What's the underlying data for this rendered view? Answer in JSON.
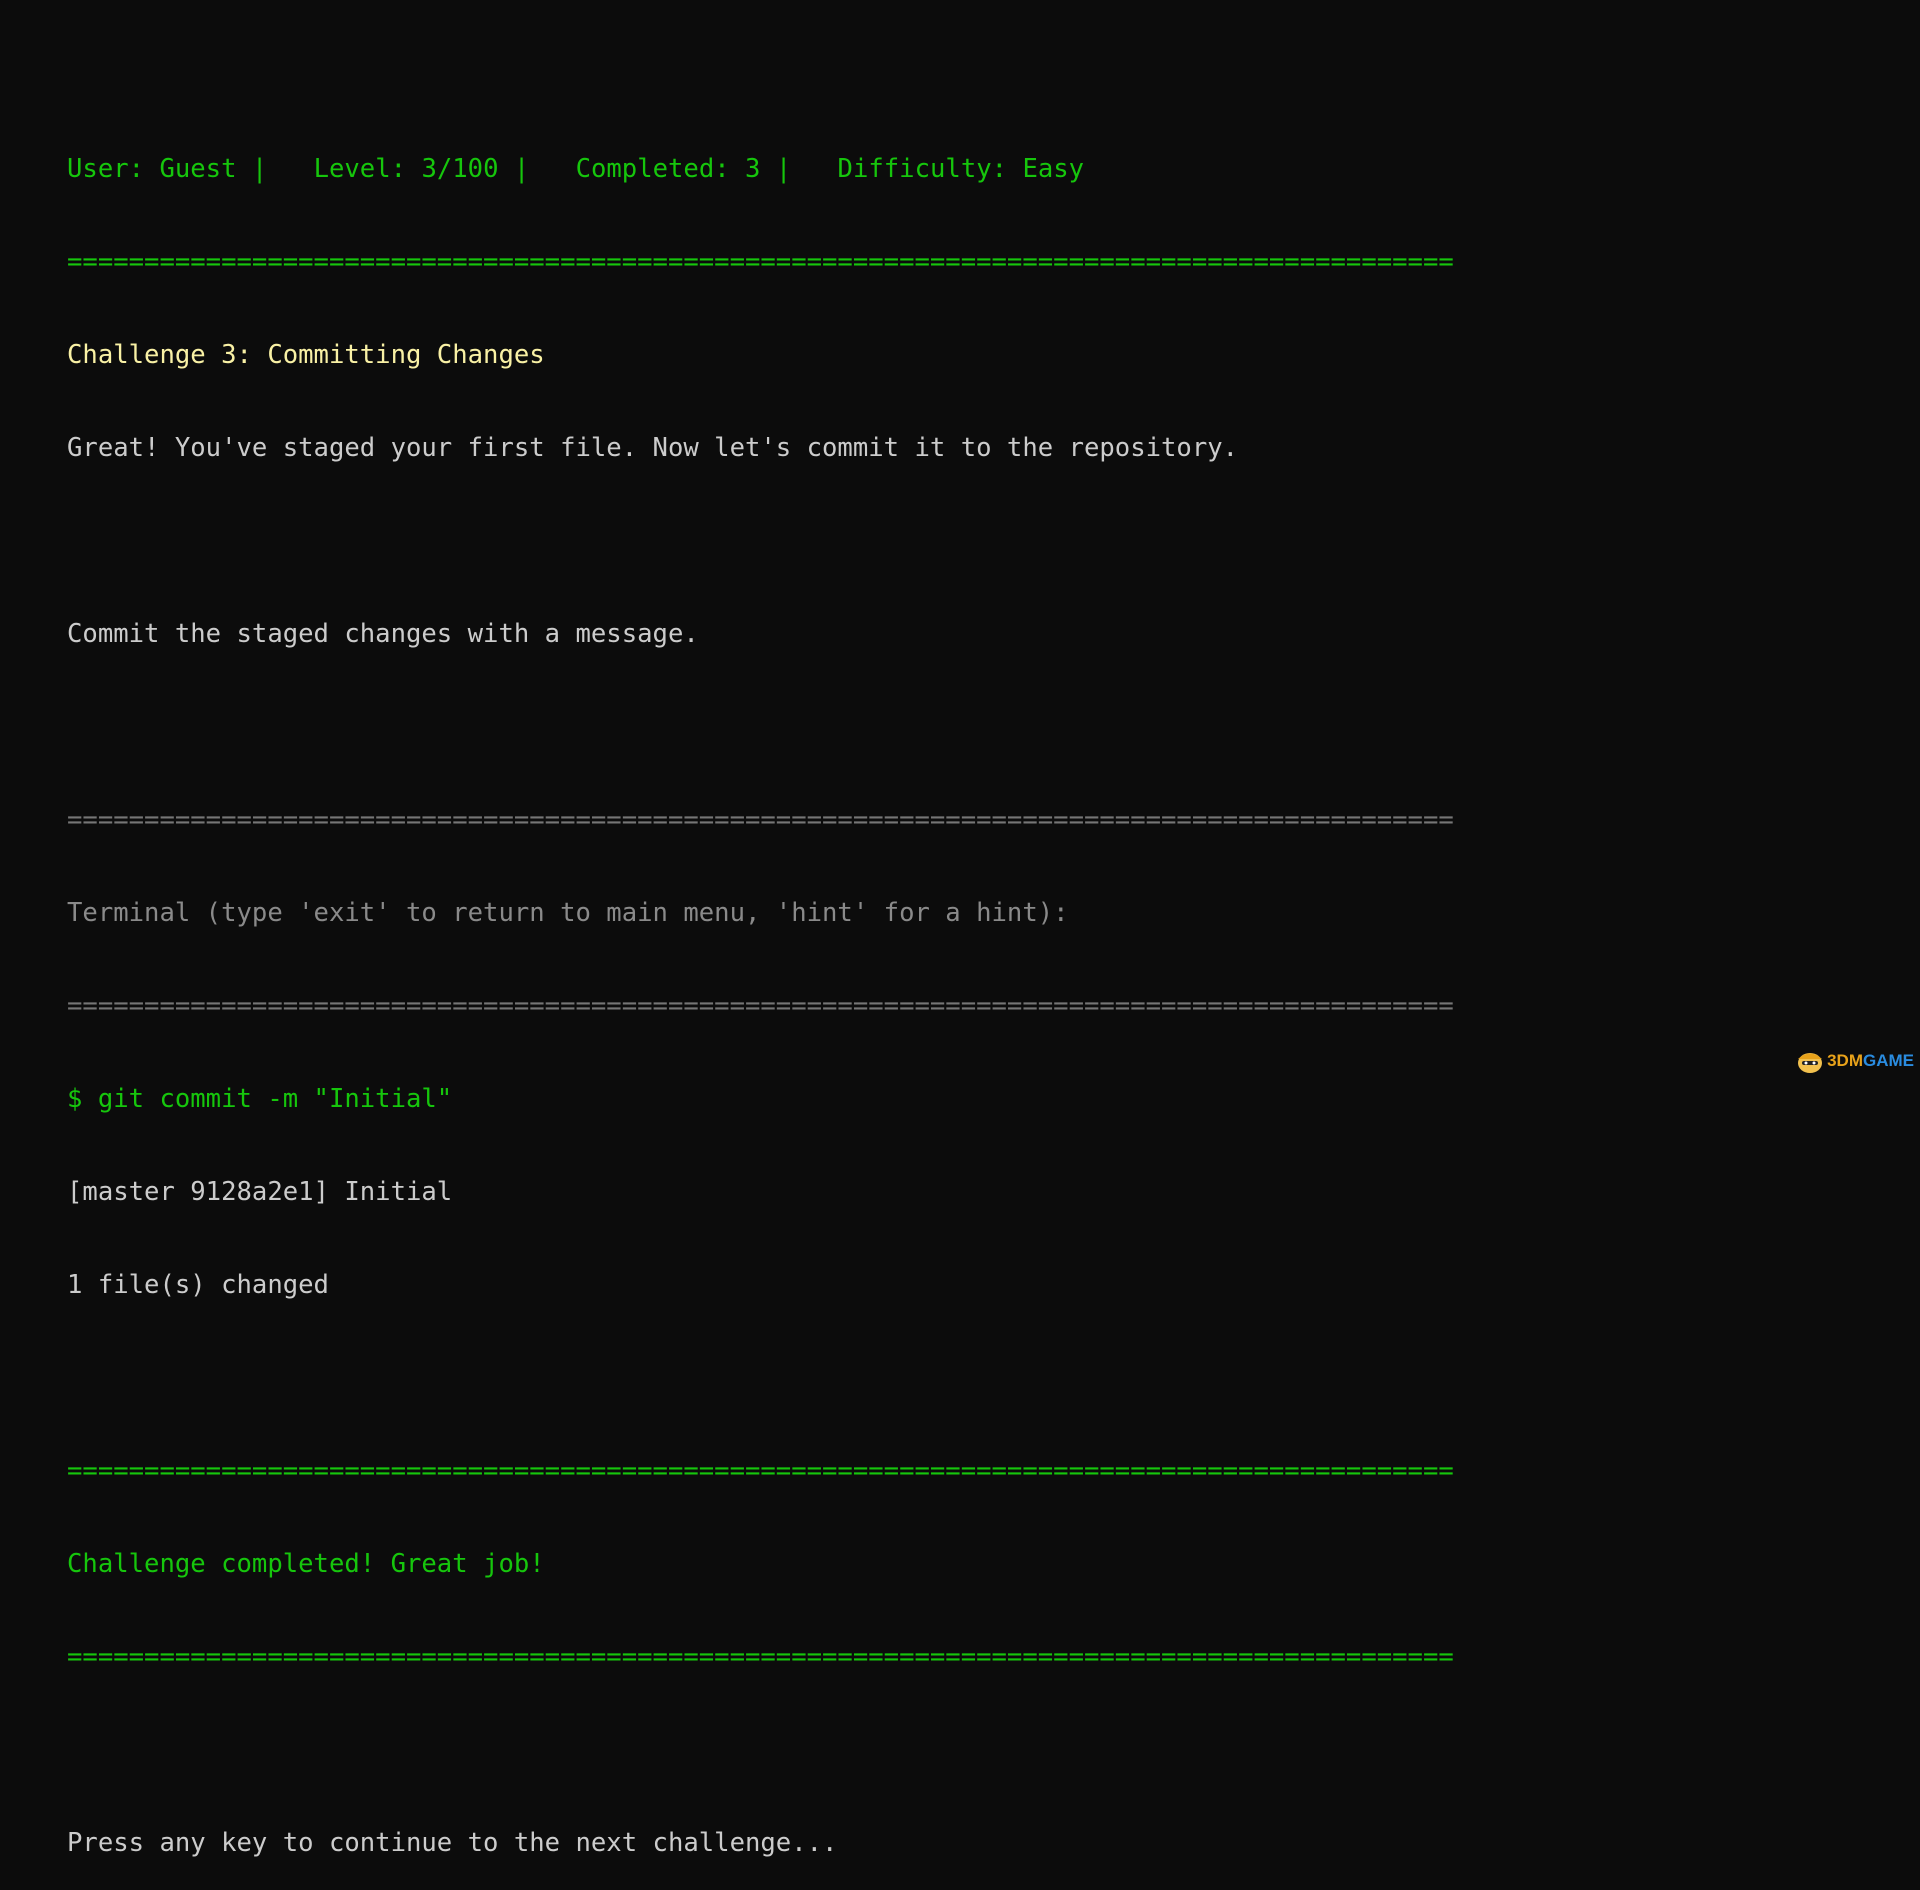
{
  "status": {
    "user": "User: Guest",
    "level": "Level: 3/100",
    "completed": "Completed: 3",
    "difficulty": "Difficulty: Easy",
    "separator": "|"
  },
  "separator_line": "==========================================================================================",
  "challenge": {
    "title": "Challenge 3: Committing Changes",
    "description": "Great! You've staged your first file. Now let's commit it to the repository.",
    "task": "Commit the staged changes with a message."
  },
  "terminal": {
    "prompt_text": "Terminal (type 'exit' to return to main menu, 'hint' for a hint):",
    "command": "$ git commit -m \"Initial\"",
    "output": [
      "[master 9128a2e1] Initial",
      "1 file(s) changed"
    ]
  },
  "result": {
    "message": "Challenge completed! Great job!"
  },
  "continue_prompt": "Press any key to continue to the next challenge...",
  "watermark": {
    "part1": "3DM",
    "part2": "GAME"
  },
  "colors": {
    "background": "#0c0c0c",
    "green": "#16c60c",
    "yellow": "#f9f1a5",
    "white": "#cccccc",
    "gray": "#8a8a8a"
  }
}
